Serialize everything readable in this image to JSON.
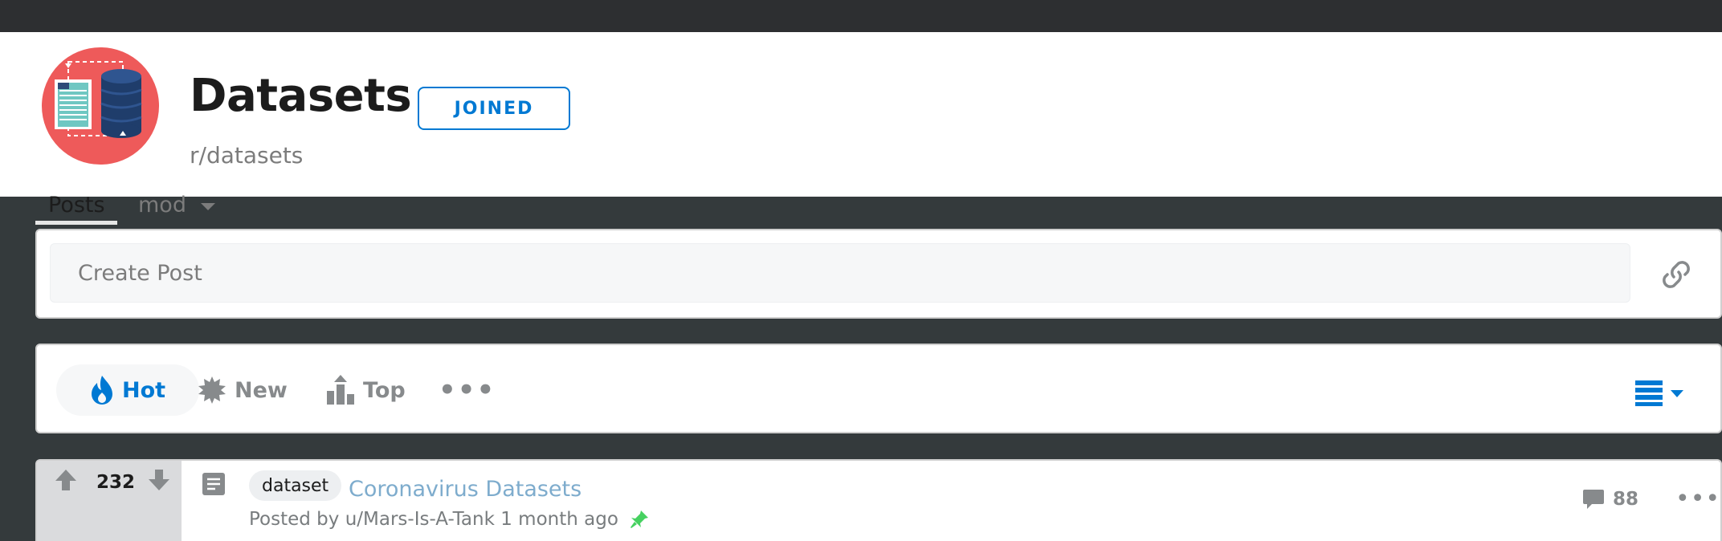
{
  "subreddit": {
    "title": "Datasets",
    "name": "r/datasets",
    "join_button_label": "JOINED",
    "logo_icon": "database-document-logo",
    "banner_color": "#ee5a5a"
  },
  "tabs": [
    {
      "label": "Posts",
      "active": true
    },
    {
      "label": "mod",
      "active": false,
      "has_dropdown": true
    }
  ],
  "create_post": {
    "placeholder": "Create Post",
    "link_icon": "link-icon"
  },
  "sort": {
    "options": [
      {
        "label": "Hot",
        "icon": "flame-icon",
        "active": true
      },
      {
        "label": "New",
        "icon": "burst-icon",
        "active": false
      },
      {
        "label": "Top",
        "icon": "top-chart-icon",
        "active": false
      }
    ],
    "more_label": "•••",
    "view_icon": "card-view-icon"
  },
  "posts": [
    {
      "score": "232",
      "flair": "dataset",
      "title": "Coronavirus Datasets",
      "meta": "Posted by u/Mars-Is-A-Tank 1 month ago",
      "pinned": true,
      "comments": "88",
      "more_label": "•••"
    }
  ],
  "colors": {
    "accent": "#0079d3",
    "page_background": "#343a3c",
    "topbar": "#2d2f31",
    "pin": "#46d160"
  }
}
